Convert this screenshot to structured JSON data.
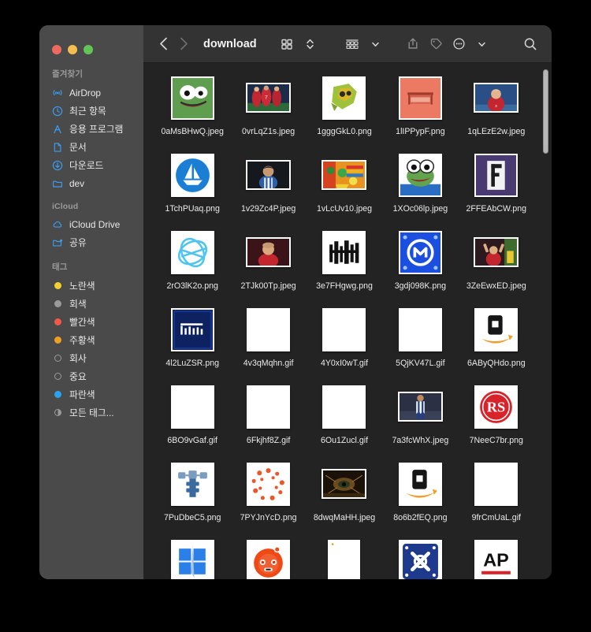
{
  "window": {
    "title": "download",
    "traffic_lights": [
      {
        "name": "close",
        "color": "#ec6a5f"
      },
      {
        "name": "minimize",
        "color": "#f4bd50"
      },
      {
        "name": "maximize",
        "color": "#61c454"
      }
    ]
  },
  "toolbar": {
    "back_label": "‹",
    "forward_label": "›",
    "title": "download",
    "buttons": [
      {
        "name": "view-icons",
        "icon": "grid-icon"
      },
      {
        "name": "view-switch",
        "icon": "chevron-updown-icon"
      },
      {
        "name": "group-by",
        "icon": "group-rows-icon"
      },
      {
        "name": "group-by-chevron",
        "icon": "chevron-down-icon"
      },
      {
        "name": "share",
        "icon": "share-icon"
      },
      {
        "name": "tag",
        "icon": "tag-icon"
      },
      {
        "name": "more-actions",
        "icon": "ellipsis-circle-icon"
      },
      {
        "name": "more-chevron",
        "icon": "chevron-down-icon"
      },
      {
        "name": "search",
        "icon": "search-icon"
      }
    ]
  },
  "sidebar": {
    "sections": [
      {
        "title": "즐겨찾기",
        "items": [
          {
            "label": "AirDrop",
            "icon": "airdrop-icon",
            "key": "airdrop"
          },
          {
            "label": "최근 항목",
            "icon": "clock-icon",
            "key": "recents"
          },
          {
            "label": "응용 프로그램",
            "icon": "applications-icon",
            "key": "applications"
          },
          {
            "label": "문서",
            "icon": "document-icon",
            "key": "documents"
          },
          {
            "label": "다운로드",
            "icon": "download-icon",
            "key": "downloads"
          },
          {
            "label": "dev",
            "icon": "folder-icon",
            "key": "dev"
          }
        ]
      },
      {
        "title": "iCloud",
        "items": [
          {
            "label": "iCloud Drive",
            "icon": "cloud-icon",
            "key": "icloud-drive"
          },
          {
            "label": "공유",
            "icon": "shared-folder-icon",
            "key": "shared"
          }
        ]
      },
      {
        "title": "태그",
        "items": [
          {
            "label": "노란색",
            "icon": "tag-dot-icon",
            "key": "yellow",
            "color": "#f2d230",
            "style": "filled"
          },
          {
            "label": "회색",
            "icon": "tag-dot-icon",
            "key": "gray",
            "color": "#9a9a9a",
            "style": "filled"
          },
          {
            "label": "빨간색",
            "icon": "tag-dot-icon",
            "key": "red",
            "color": "#f2594b",
            "style": "filled"
          },
          {
            "label": "주황색",
            "icon": "tag-dot-icon",
            "key": "orange",
            "color": "#f0a020",
            "style": "filled"
          },
          {
            "label": "회사",
            "icon": "tag-ring-icon",
            "key": "company",
            "color": "#9a9a9a",
            "style": "ring"
          },
          {
            "label": "중요",
            "icon": "tag-ring-icon",
            "key": "important",
            "color": "#9a9a9a",
            "style": "ring"
          },
          {
            "label": "파란색",
            "icon": "tag-dot-icon",
            "key": "blue",
            "color": "#2aa3ef",
            "style": "filled"
          },
          {
            "label": "모든 태그...",
            "icon": "tag-all-icon",
            "key": "all-tags",
            "color": "#9a9a9a",
            "style": "half"
          }
        ]
      }
    ]
  },
  "files": [
    {
      "name": "0aMsBHwQ.jpeg",
      "art": "pepe-green",
      "shape": "sq"
    },
    {
      "name": "0vrLqZ1s.jpeg",
      "art": "soccer-red",
      "shape": "wide"
    },
    {
      "name": "1gggGkL0.png",
      "art": "green-blob",
      "shape": "sq"
    },
    {
      "name": "1lIPPypF.png",
      "art": "salmon-banner",
      "shape": "sq"
    },
    {
      "name": "1qLEzE2w.jpeg",
      "art": "soccer-player",
      "shape": "wide"
    },
    {
      "name": "1TchPUaq.png",
      "art": "blue-circle-boat",
      "shape": "sq"
    },
    {
      "name": "1v29Zc4P.jpeg",
      "art": "player-dark",
      "shape": "wide"
    },
    {
      "name": "1vLcUv10.jpeg",
      "art": "colorful-art",
      "shape": "wide"
    },
    {
      "name": "1XOc06lp.jpeg",
      "art": "pepe-white",
      "shape": "sq"
    },
    {
      "name": "2FFEAbCW.png",
      "art": "purple-f",
      "shape": "sq"
    },
    {
      "name": "2rO3lK2o.png",
      "art": "cyan-globe",
      "shape": "sq"
    },
    {
      "name": "2TJk00Tp.jpeg",
      "art": "player-red",
      "shape": "wide"
    },
    {
      "name": "3e7FHgwg.png",
      "art": "black-glyphs",
      "shape": "sq"
    },
    {
      "name": "3gdj098K.png",
      "art": "blue-m-badge",
      "shape": "sq"
    },
    {
      "name": "3ZeEwxED.jpeg",
      "art": "celebrate-red",
      "shape": "wide"
    },
    {
      "name": "4l2LuZSR.png",
      "art": "navy-text",
      "shape": "sq"
    },
    {
      "name": "4v3qMqhn.gif",
      "art": "blank",
      "shape": "sq"
    },
    {
      "name": "4Y0xI0wT.gif",
      "art": "blank",
      "shape": "sq"
    },
    {
      "name": "5QjKV47L.gif",
      "art": "blank",
      "shape": "sq"
    },
    {
      "name": "6AByQHdo.png",
      "art": "amazon-logo",
      "shape": "sq"
    },
    {
      "name": "6BO9vGaf.gif",
      "art": "blank",
      "shape": "sq"
    },
    {
      "name": "6Fkjhf8Z.gif",
      "art": "blank",
      "shape": "sq"
    },
    {
      "name": "6Ou1Zucl.gif",
      "art": "blank",
      "shape": "sq"
    },
    {
      "name": "7a3fcWhX.jpeg",
      "art": "player-stripes",
      "shape": "wide"
    },
    {
      "name": "7NeeC7br.png",
      "art": "rs-red-logo",
      "shape": "sq"
    },
    {
      "name": "7PuDbeC5.png",
      "art": "blue-tower",
      "shape": "sq"
    },
    {
      "name": "7PYJnYcD.png",
      "art": "orange-ring",
      "shape": "sq"
    },
    {
      "name": "8dwqMaHH.jpeg",
      "art": "dark-scene",
      "shape": "wide"
    },
    {
      "name": "8o6b2fEQ.png",
      "art": "amazon-logo",
      "shape": "sq"
    },
    {
      "name": "9frCmUaL.gif",
      "art": "blank",
      "shape": "sq"
    },
    {
      "name": "",
      "art": "windows-logo",
      "shape": "sq"
    },
    {
      "name": "",
      "art": "reddit-logo",
      "shape": "sq"
    },
    {
      "name": "",
      "art": "blank-doc",
      "shape": "tall"
    },
    {
      "name": "",
      "art": "blue-x-badge",
      "shape": "sq"
    },
    {
      "name": "",
      "art": "ap-logo",
      "shape": "sq"
    }
  ],
  "scrollbar": {
    "name": "vertical-scrollbar",
    "position_percent": 2
  }
}
